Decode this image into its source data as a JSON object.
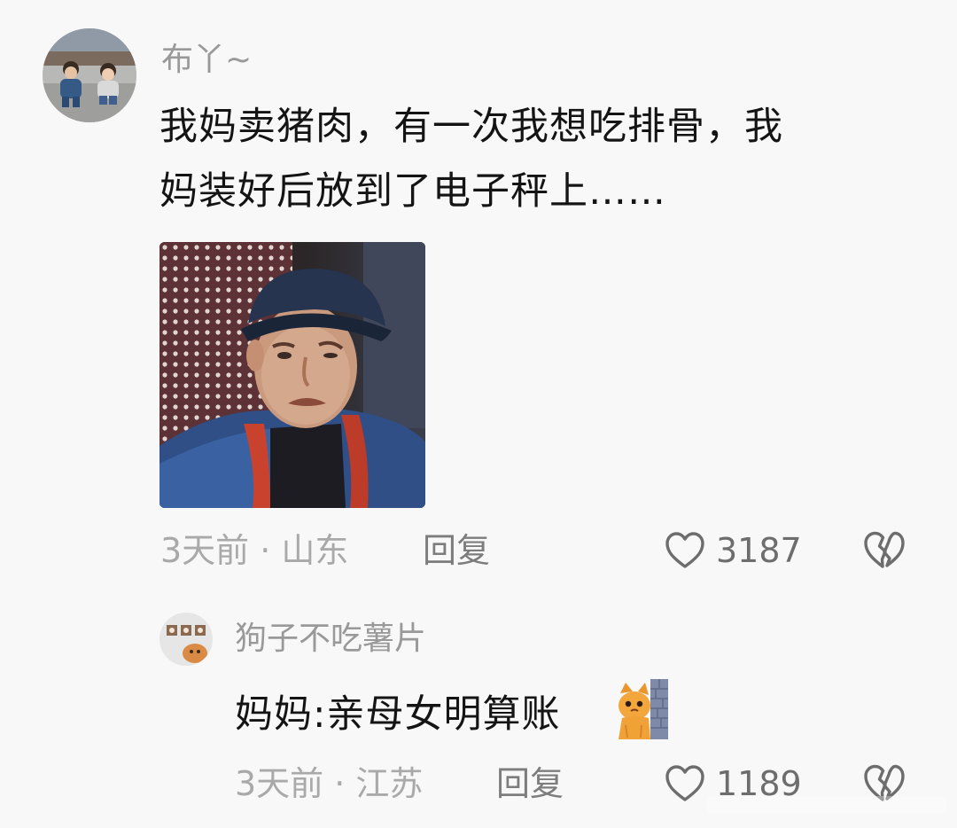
{
  "thread": {
    "main_comment": {
      "username": "布丫~",
      "text_line1": "我妈卖猪肉，有一次我想吃排骨，我",
      "text_line2": "妈装好后放到了电子秤上……",
      "time_location": "3天前 · 山东",
      "reply_label": "回复",
      "like_count": "3187",
      "icons": [
        "avatar",
        "heart-outline-icon",
        "broken-heart-icon"
      ]
    },
    "reply_comment": {
      "username": "狗子不吃薯片",
      "text": "妈妈:亲母女明算账",
      "emoji": "cat-peeking-from-wall-emoji",
      "time_location": "3天前 · 江苏",
      "reply_label": "回复",
      "like_count": "1189",
      "icons": [
        "avatar",
        "heart-outline-icon",
        "broken-heart-icon"
      ]
    }
  },
  "colors": {
    "background": "#f8f8f8",
    "username": "#999999",
    "comment_text": "#141414",
    "meta": "#a9a9a9",
    "reply_link": "#7d7d7d",
    "icon_stroke": "#6d6d6d"
  }
}
